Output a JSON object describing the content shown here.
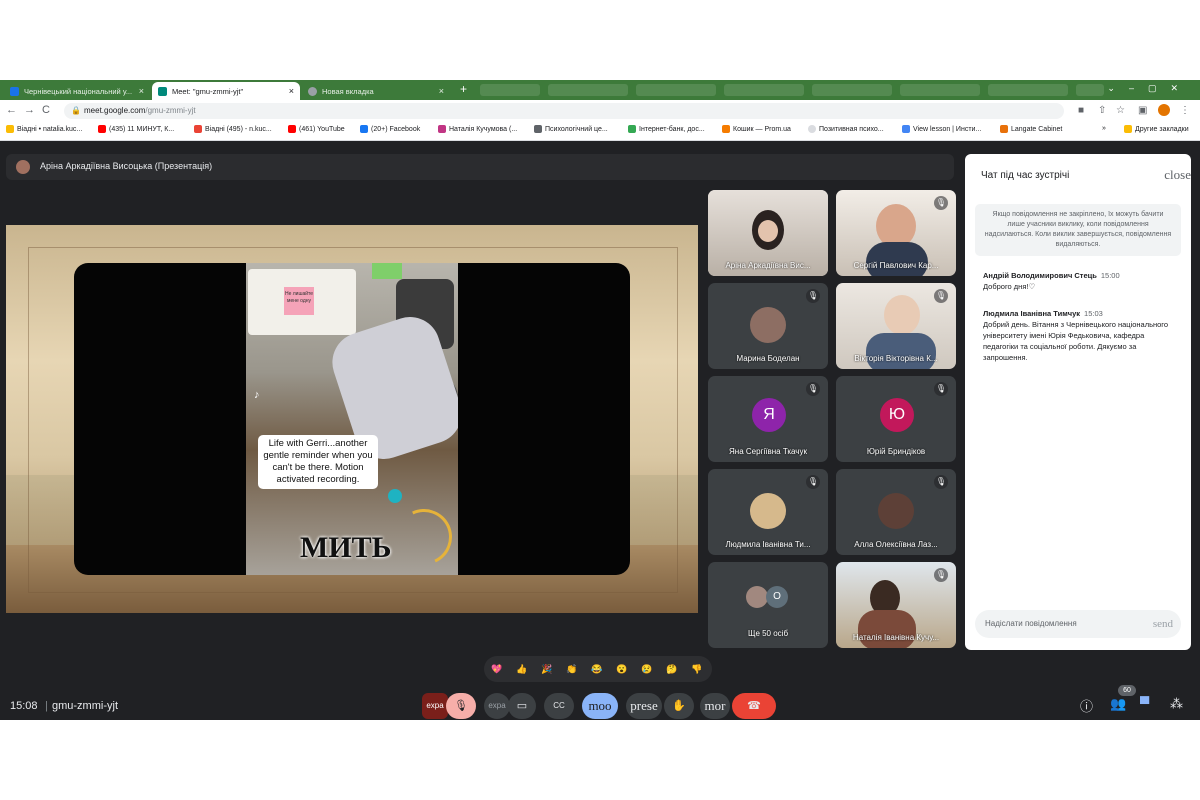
{
  "browser": {
    "tabs": [
      {
        "label": "Чернівецький національний у...",
        "active": false
      },
      {
        "label": "Meet: \"gmu-zmmi-yjt\"",
        "active": true
      },
      {
        "label": "Новая вкладка",
        "active": false
      }
    ],
    "url_host": "meet.google.com",
    "url_path": "/gmu-zmmi-yjt",
    "bookmarks": [
      "Віадні • natalia.kuc...",
      "(435) 11 МИНУТ, К...",
      "Віадні (495) - n.kuc...",
      "(461) YouTube",
      "(20+) Facebook",
      "Наталія Кучумова (...",
      "Психологічний це...",
      "Інтернет-банк, дос...",
      "Кошик — Prom.ua",
      "Позитивная психо...",
      "View lesson | Инсти...",
      "Langate Cabinet",
      "Другие закладки"
    ]
  },
  "meet": {
    "presenter_label": "Аріна Аркадіївна Висоцька (Презентація)",
    "slide": {
      "note_text": "Не лишайте мене одну",
      "caption": "Life with Gerri...another gentle reminder when you can't be there. Motion activated recording.",
      "big_word": "МИТЬ",
      "tiktok_mark": "♪"
    },
    "participants": [
      {
        "name": "Аріна Аркадіївна Вис...",
        "type": "video",
        "muted": false
      },
      {
        "name": "Сергій Павлович Кар...",
        "type": "video",
        "muted": true
      },
      {
        "name": "Марина Боделан",
        "type": "photo",
        "muted": true
      },
      {
        "name": "Вікторія Вікторівна К...",
        "type": "video",
        "muted": true
      },
      {
        "name": "Яна Сергіївна Ткачук",
        "type": "letter",
        "letter": "Я",
        "color": "#8e24aa",
        "muted": true
      },
      {
        "name": "Юрій Бриндіков",
        "type": "letter",
        "letter": "Ю",
        "color": "#c2185b",
        "muted": true
      },
      {
        "name": "Людмила Іванівна Ти...",
        "type": "photo",
        "muted": true
      },
      {
        "name": "Алла Олексіївна Лаз...",
        "type": "photo",
        "muted": true
      },
      {
        "name": "Ще 50 осіб",
        "type": "more",
        "letter": "О",
        "muted": false
      },
      {
        "name": "Наталія Іванівна Кучу...",
        "type": "video",
        "muted": true
      }
    ],
    "chat": {
      "title": "Чат під час зустрічі",
      "close_label": "close",
      "notice": "Якщо повідомлення не закріплено, їх можуть бачити лише учасники виклику, коли повідомлення надсилаються. Коли виклик завершується, повідомлення видаляються.",
      "messages": [
        {
          "author": "Андрій Володимирович Стець",
          "time": "15:00",
          "text": "Доброго дня!♡"
        },
        {
          "author": "Людмила Іванівна Тимчук",
          "time": "15:03",
          "text": "Добрий день. Вітання з Чернівецького національного університету імені Юрія Федьковича, кафедра педагогіки та соціальної роботи. Дякуємо за запрошення."
        }
      ],
      "input_placeholder": "Надіслати повідомлення",
      "send_label": "send"
    },
    "reactions": [
      "💖",
      "👍",
      "🎉",
      "👏",
      "😂",
      "😮",
      "😢",
      "🤔",
      "👎"
    ],
    "clock": "15:08",
    "meeting_code": "gmu-zmmi-yjt",
    "controls": {
      "expand_label": "expa",
      "mic_icon": "🎙",
      "expand2_label": "expa",
      "cam_icon": "▭",
      "cc_icon": "CC",
      "mood_label": "moo",
      "present_label": "prese",
      "hand_icon": "✋",
      "more_label": "mor",
      "end_icon": "☎"
    },
    "people_count": "60"
  }
}
